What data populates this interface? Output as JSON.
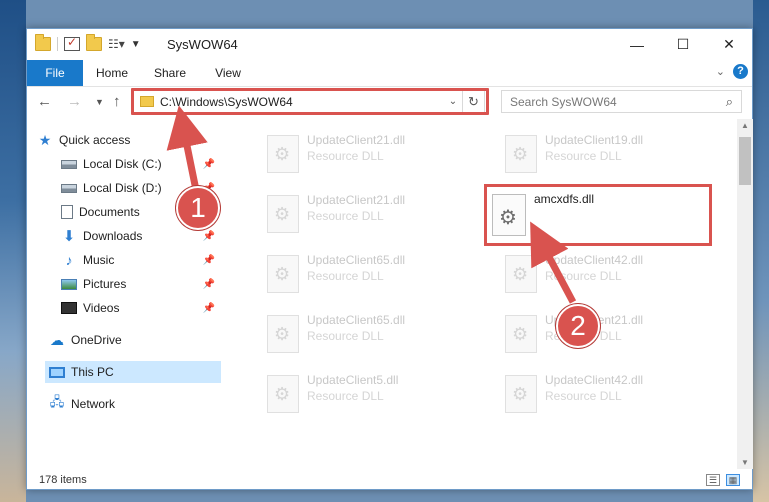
{
  "window": {
    "title": "SysWOW64",
    "controls": {
      "minimize": "—",
      "maximize": "☐",
      "close": "✕"
    }
  },
  "ribbon": {
    "tabs": [
      "File",
      "Home",
      "Share",
      "View"
    ]
  },
  "navigation": {
    "address": "C:\\Windows\\SysWOW64",
    "search_placeholder": "Search SysWOW64"
  },
  "sidebar": {
    "items": [
      {
        "label": "Quick access",
        "icon": "star-icon"
      },
      {
        "label": "Local Disk (C:)",
        "icon": "drive-icon",
        "pinned": true
      },
      {
        "label": "Local Disk (D:)",
        "icon": "drive-icon",
        "pinned": true
      },
      {
        "label": "Documents",
        "icon": "documents-icon",
        "pinned": true
      },
      {
        "label": "Downloads",
        "icon": "downloads-icon",
        "pinned": true
      },
      {
        "label": "Music",
        "icon": "music-icon",
        "pinned": true
      },
      {
        "label": "Pictures",
        "icon": "pictures-icon",
        "pinned": true
      },
      {
        "label": "Videos",
        "icon": "videos-icon",
        "pinned": true
      },
      {
        "label": "OneDrive",
        "icon": "onedrive-icon"
      },
      {
        "label": "This PC",
        "icon": "this-pc-icon",
        "selected": true
      },
      {
        "label": "Network",
        "icon": "network-icon"
      }
    ]
  },
  "files": [
    {
      "name": "UpdateClient21.dll",
      "type": "Resource DLL"
    },
    {
      "name": "UpdateClient19.dll",
      "type": "Resource DLL"
    },
    {
      "name": "UpdateClient21.dll",
      "type": "Resource DLL"
    },
    {
      "name": "UpdateClient65.dll",
      "type": "Resource DLL"
    },
    {
      "name": "UpdateClient42.dll",
      "type": "Resource DLL"
    },
    {
      "name": "UpdateClient65.dll",
      "type": "Resource DLL"
    },
    {
      "name": "UpdateClient21.dll",
      "type": "Resource DLL"
    },
    {
      "name": "UpdateClient5.dll",
      "type": "Resource DLL"
    },
    {
      "name": "UpdateClient42.dll",
      "type": "Resource DLL"
    }
  ],
  "highlighted_file": {
    "name": "amcxdfs.dll"
  },
  "status": {
    "item_count": "178 items"
  },
  "annotations": {
    "badge1": "1",
    "badge2": "2",
    "color": "#d9534f"
  }
}
